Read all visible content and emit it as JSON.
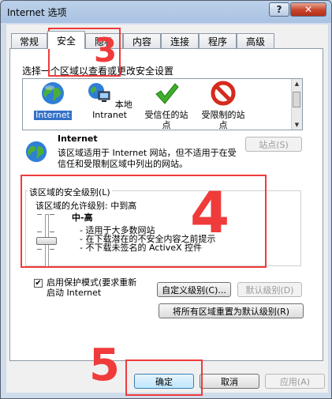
{
  "window": {
    "title": "Internet 选项",
    "help": "?",
    "close": "✕"
  },
  "tabs": [
    {
      "label": "常规"
    },
    {
      "label": "安全"
    },
    {
      "label": "隐私"
    },
    {
      "label": "内容"
    },
    {
      "label": "连接"
    },
    {
      "label": "程序"
    },
    {
      "label": "高级"
    }
  ],
  "zones": {
    "prompt": "选择一个区域以查看或更改安全设置",
    "items": [
      {
        "line1": "Internet",
        "line2": ""
      },
      {
        "line1": "本地",
        "line2": "Intranet"
      },
      {
        "line1": "受信任的站",
        "line2": "点"
      },
      {
        "line1": "受限制的站",
        "line2": "点"
      }
    ]
  },
  "info": {
    "title": "Internet",
    "desc": "该区域适用于 Internet 网站，但不适用于在受信任和受限制区域中列出的网站。",
    "sites_button": "站点(S)"
  },
  "security_level": {
    "group_title": "该区域的安全级别(L)",
    "allowed": "该区域的允许级别: 中到高",
    "level": "中-高",
    "bullets": [
      "- 适用于大多数网站",
      "- 在下载潜在的不安全内容之前提示",
      "- 不下载未签名的 ActiveX 控件"
    ]
  },
  "protected_mode": {
    "checked": "✔",
    "line1": "启用保护模式(要求重新",
    "line2": "启动 Internet"
  },
  "buttons": {
    "custom_level": "自定义级别(C)...",
    "default_level": "默认级别(D)",
    "reset_all": "将所有区域重置为默认级别(R)",
    "ok": "确定",
    "cancel": "取消",
    "apply": "应用(A)"
  },
  "annotations": {
    "three": "3",
    "four": "4",
    "five": "5"
  },
  "colors": {
    "annotation": "#f03b3b",
    "selection": "#3470c6"
  }
}
